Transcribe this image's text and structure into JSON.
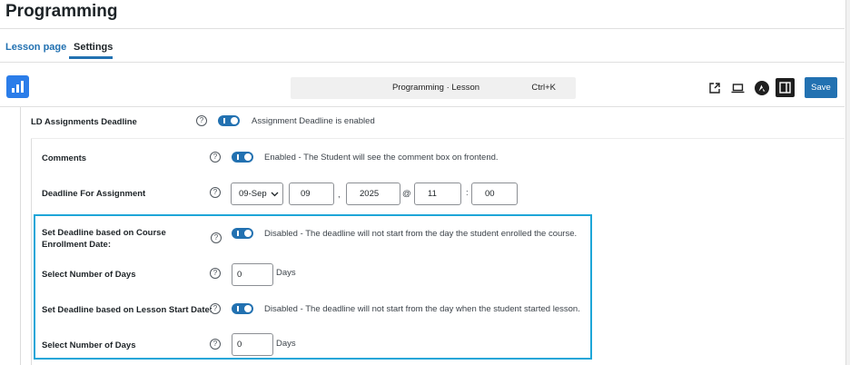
{
  "page": {
    "title": "Programming"
  },
  "tabs": [
    {
      "label": "Lesson page"
    },
    {
      "label": "Settings"
    }
  ],
  "toolbar": {
    "command_bar_label": "Programming · Lesson",
    "command_shortcut": "Ctrl+K",
    "save_label": "Save",
    "icons": [
      "chart-app-icon",
      "external-link-icon",
      "preview-icon",
      "astra-icon",
      "sidebar-toggle-icon"
    ]
  },
  "settings": {
    "assignments_deadline": {
      "label": "LD Assignments Deadline",
      "status": "Assignment Deadline is enabled",
      "toggle_on": true
    },
    "comments": {
      "label": "Comments",
      "status": "Enabled - The Student will see the comment box on frontend.",
      "toggle_on": true
    },
    "deadline_for_assignment": {
      "label": "Deadline For Assignment",
      "month": "09-Sep",
      "day": "09",
      "comma": ",",
      "year": "2025",
      "at": "@",
      "hour": "11",
      "colon": ":",
      "minute": "00"
    },
    "course_enrollment_deadline": {
      "label": "Set Deadline based on Course Enrollment Date:",
      "status": "Disabled - The deadline will not start from the day the student enrolled the course.",
      "toggle_on": true
    },
    "enrollment_days": {
      "label": "Select Number of Days",
      "value": "0",
      "unit": "Days"
    },
    "lesson_start_deadline": {
      "label": "Set Deadline based on Lesson Start Date:",
      "status": "Disabled - The deadline will not start from the day when the student started lesson.",
      "toggle_on": true
    },
    "lesson_days": {
      "label": "Select Number of Days",
      "value": "0",
      "unit": "Days"
    }
  },
  "colors": {
    "accent": "#2271b1",
    "highlight_border": "#1ea6d8",
    "app_icon": "#2b7de9"
  }
}
